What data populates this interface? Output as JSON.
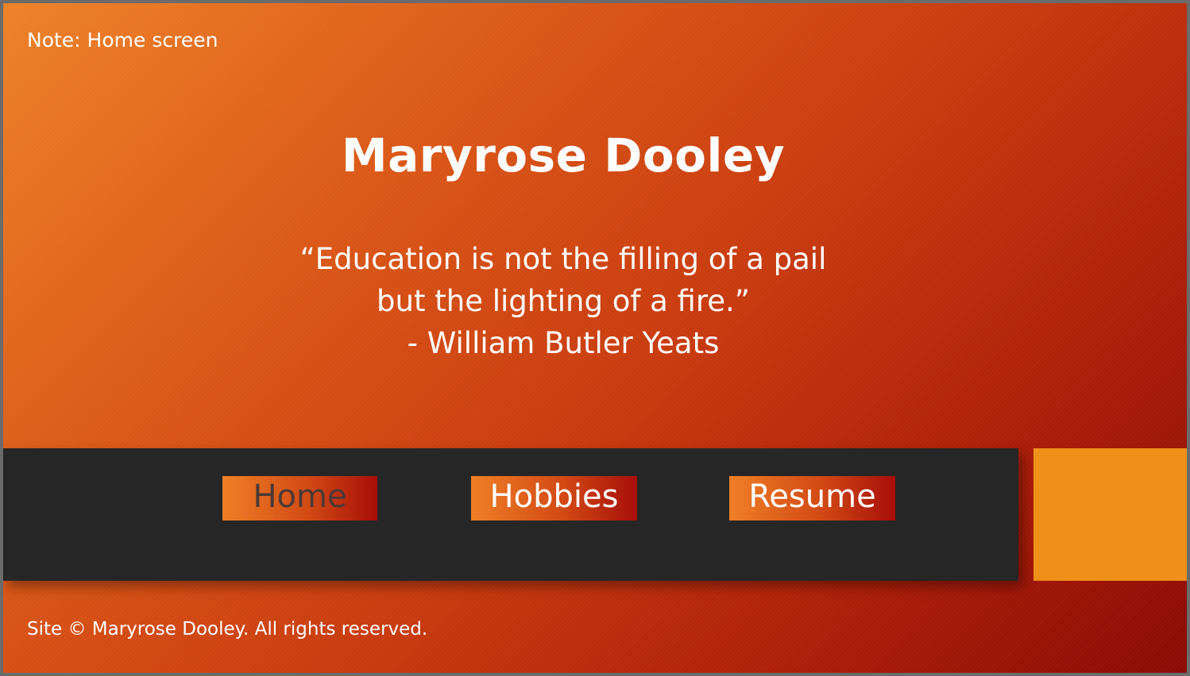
{
  "note": "Note: Home screen",
  "title": "Maryrose Dooley",
  "quote": {
    "line1": "“Education is not the filling of a pail",
    "line2": "but the lighting of a fire.”",
    "attribution": "- William Butler Yeats"
  },
  "nav": {
    "home": "Home",
    "hobbies": "Hobbies",
    "resume": "Resume",
    "active": "home"
  },
  "footer": "Site © Maryrose Dooley. All rights reserved.",
  "colors": {
    "background_start": "#ee8228",
    "background_end": "#8a0a04",
    "navbar": "#262626",
    "accent_block": "#ef9018",
    "active_nav_text": "#4a3a36"
  }
}
